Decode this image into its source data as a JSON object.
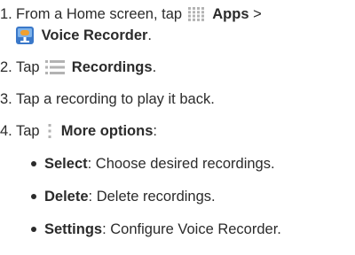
{
  "steps": [
    {
      "number": "1.",
      "line1_prefix": "From a Home screen, tap",
      "icon1": "apps-grid-icon",
      "line1_bold": "Apps",
      "line1_suffix": ">",
      "icon2": "voice-recorder-app-icon",
      "line2_bold": "Voice Recorder",
      "line2_suffix": "."
    },
    {
      "number": "2.",
      "prefix": "Tap",
      "icon": "recordings-list-icon",
      "bold": "Recordings",
      "suffix": "."
    },
    {
      "number": "3.",
      "text": "Tap a recording to play it back."
    },
    {
      "number": "4.",
      "prefix": "Tap",
      "icon": "more-options-icon",
      "bold": "More options",
      "suffix": ":"
    }
  ],
  "bullets": [
    {
      "bold": "Select",
      "text": ": Choose desired recordings."
    },
    {
      "bold": "Delete",
      "text": ": Delete recordings."
    },
    {
      "bold": "Settings",
      "text": ": Configure Voice Recorder."
    }
  ],
  "colors": {
    "text": "#2b2b2b",
    "icon_gray": "#b3b3b3",
    "recorder_blue": "#3a78c9",
    "recorder_orange": "#f0a030"
  }
}
